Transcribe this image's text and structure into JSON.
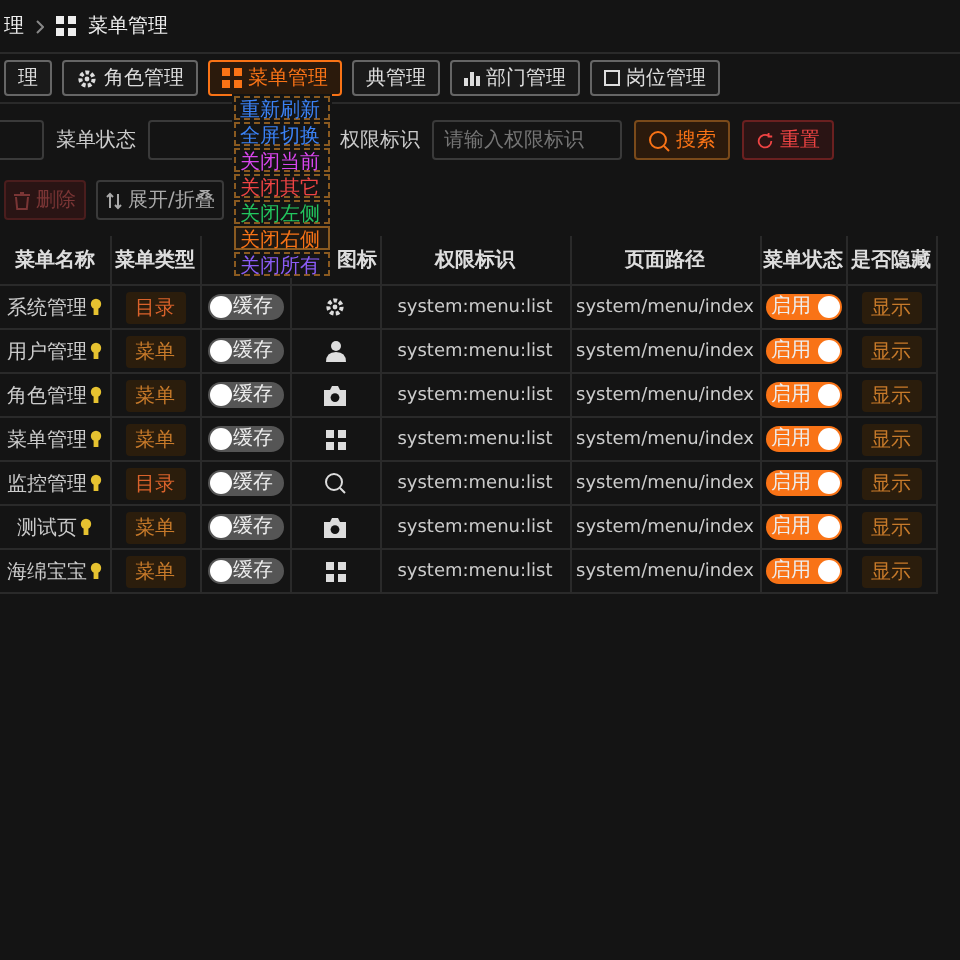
{
  "breadcrumb": [
    {
      "label": "理"
    },
    {
      "label": "菜单管理"
    }
  ],
  "tabs": [
    {
      "label": "理",
      "selected": false,
      "kind": "plain"
    },
    {
      "label": "角色管理",
      "selected": false,
      "kind": "gear"
    },
    {
      "label": "菜单管理",
      "selected": true,
      "kind": "grid"
    },
    {
      "label": "典管理",
      "selected": false,
      "kind": "plain"
    },
    {
      "label": "部门管理",
      "selected": false,
      "kind": "chart"
    },
    {
      "label": "岗位管理",
      "selected": false,
      "kind": "box"
    }
  ],
  "context_menu": [
    {
      "label": "重新刷新",
      "color": "#3b82f6",
      "selected": false
    },
    {
      "label": "全屏切换",
      "color": "#3b82f6",
      "selected": false
    },
    {
      "label": "关闭当前",
      "color": "#d946ef",
      "selected": false
    },
    {
      "label": "关闭其它",
      "color": "#ef4444",
      "selected": false
    },
    {
      "label": "关闭左侧",
      "color": "#22c55e",
      "selected": false
    },
    {
      "label": "关闭右侧",
      "color": "#f97316",
      "selected": true
    },
    {
      "label": "关闭所有",
      "color": "#8b5cf6",
      "selected": false
    }
  ],
  "search": {
    "status_label": "菜单状态",
    "perm_label": "权限标识",
    "perm_placeholder": "请输入权限标识",
    "search_button": "搜索",
    "reset_button": "重置"
  },
  "actions": {
    "delete_button": "删除",
    "delete_disabled": true,
    "expand_button": "展开/折叠"
  },
  "table": {
    "columns": [
      "菜单名称",
      "菜单类型",
      "",
      "图标",
      "权限标识",
      "页面路径",
      "菜单状态",
      "是否隐藏"
    ],
    "rows": [
      {
        "name": "系统管理",
        "type": "目录",
        "cache_on": false,
        "cache_label": "缓存",
        "kind": "gear",
        "perm": "system:menu:list",
        "path": "system/menu/index",
        "status_on": true,
        "status_label": "启用",
        "hidden": "显示"
      },
      {
        "name": "用户管理",
        "type": "菜单",
        "cache_on": false,
        "cache_label": "缓存",
        "kind": "user",
        "perm": "system:menu:list",
        "path": "system/menu/index",
        "status_on": true,
        "status_label": "启用",
        "hidden": "显示"
      },
      {
        "name": "角色管理",
        "type": "菜单",
        "cache_on": false,
        "cache_label": "缓存",
        "kind": "camera",
        "perm": "system:menu:list",
        "path": "system/menu/index",
        "status_on": true,
        "status_label": "启用",
        "hidden": "显示"
      },
      {
        "name": "菜单管理",
        "type": "菜单",
        "cache_on": false,
        "cache_label": "缓存",
        "kind": "grid",
        "perm": "system:menu:list",
        "path": "system/menu/index",
        "status_on": true,
        "status_label": "启用",
        "hidden": "显示"
      },
      {
        "name": "监控管理",
        "type": "目录",
        "cache_on": false,
        "cache_label": "缓存",
        "kind": "search",
        "perm": "system:menu:list",
        "path": "system/menu/index",
        "status_on": true,
        "status_label": "启用",
        "hidden": "显示"
      },
      {
        "name": "测试页",
        "type": "菜单",
        "cache_on": false,
        "cache_label": "缓存",
        "kind": "camera",
        "perm": "system:menu:list",
        "path": "system/menu/index",
        "status_on": true,
        "status_label": "启用",
        "hidden": "显示"
      },
      {
        "name": "海绵宝宝",
        "type": "菜单",
        "cache_on": false,
        "cache_label": "缓存",
        "kind": "grid",
        "perm": "system:menu:list",
        "path": "system/menu/index",
        "status_on": true,
        "status_label": "启用",
        "hidden": "显示"
      }
    ]
  }
}
